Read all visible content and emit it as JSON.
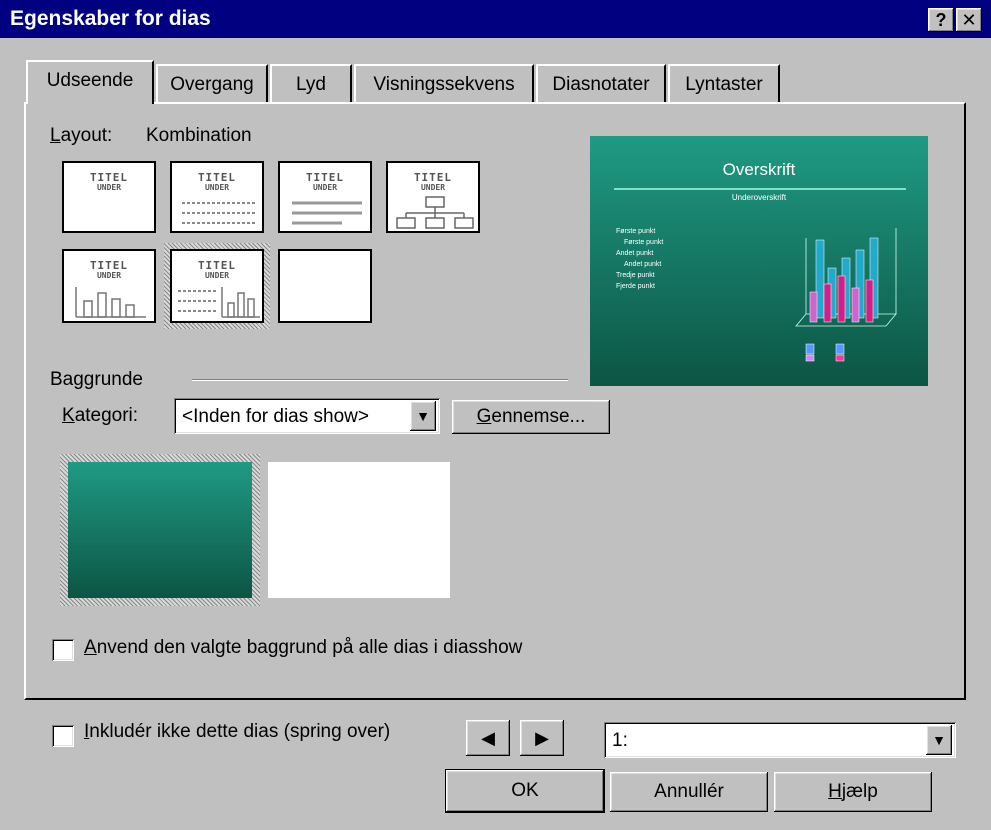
{
  "window": {
    "title": "Egenskaber for dias",
    "help_glyph": "?",
    "close_glyph": "✕"
  },
  "tabs": [
    {
      "label": "Udseende",
      "active": true
    },
    {
      "label": "Overgang"
    },
    {
      "label": "Lyd"
    },
    {
      "label": "Visningssekvens"
    },
    {
      "label": "Diasnotater"
    },
    {
      "label": "Lyntaster"
    }
  ],
  "layout": {
    "label_prefix": "L",
    "label_rest": "ayout:",
    "value": "Kombination",
    "thumb_title": "TITEL",
    "thumb_sub": "UNDER"
  },
  "preview": {
    "heading": "Overskrift",
    "subheading": "Underoverskrift",
    "bullets": [
      "Første punkt",
      "Første punkt",
      "Andet punkt",
      "Andet punkt",
      "Tredje punkt",
      "Fjerde punkt"
    ]
  },
  "background": {
    "section_label": "Baggrunde",
    "category_label_prefix": "K",
    "category_label_rest": "ategori:",
    "category_value": "<Inden for dias show>",
    "browse_prefix": "G",
    "browse_rest": "ennemse...",
    "apply_prefix": "A",
    "apply_rest": "nvend den valgte baggrund på alle dias i diasshow"
  },
  "footer": {
    "skip_prefix": "I",
    "skip_rest": "nkludér ikke dette dias (spring over)",
    "prev_glyph": "◀",
    "next_glyph": "▶",
    "slide_value": "1:",
    "ok_label": "OK",
    "cancel_label": "Annullér",
    "help_prefix": "H",
    "help_rest": "jælp"
  },
  "colors": {
    "titlebar": "#000080",
    "dialog_bg": "#c0c0c0",
    "teal_top": "#1f9a84",
    "teal_bottom": "#0c5544"
  }
}
